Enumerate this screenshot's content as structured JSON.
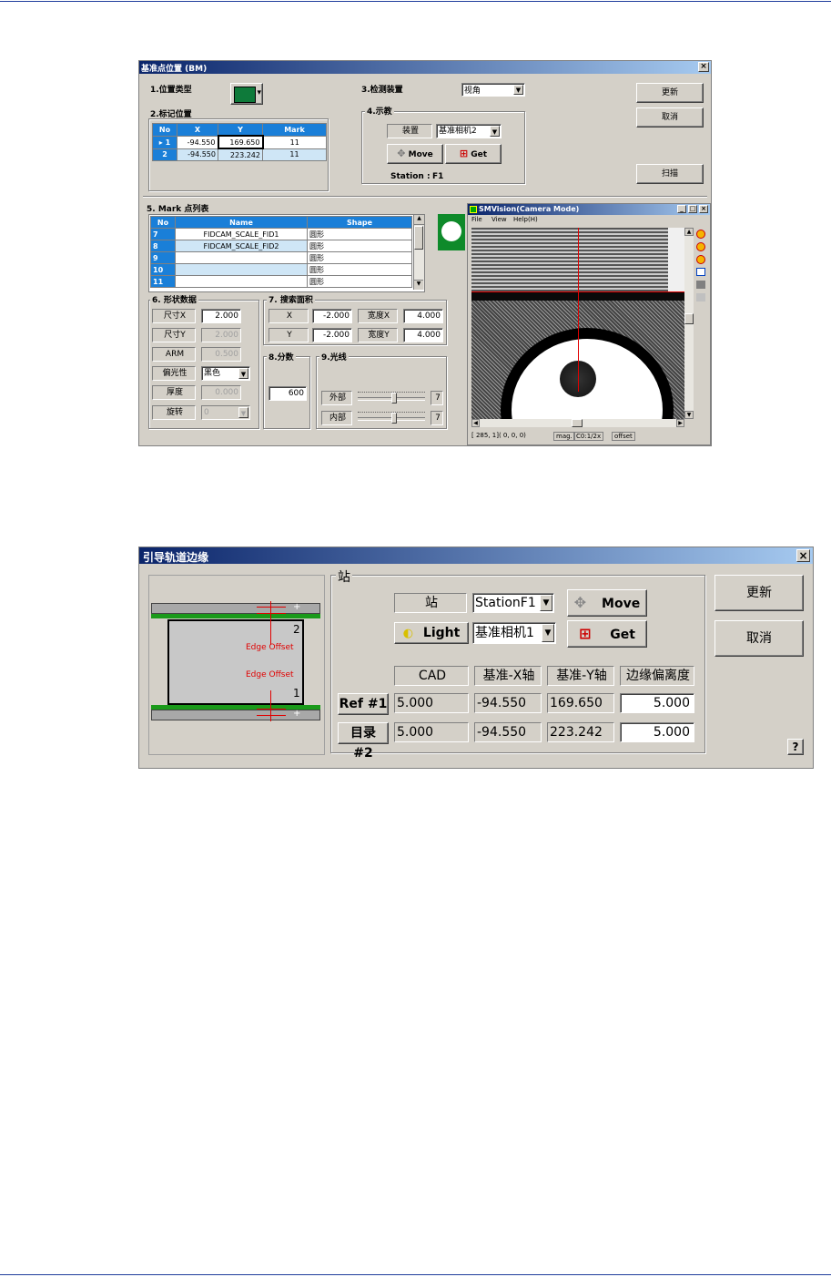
{
  "dialog1": {
    "title": "基准点位置 (BM)",
    "close_label": "×",
    "sec1_label": "1.位置类型",
    "sec2_label": "2.标记位置",
    "sec3_label": "3.检测装置",
    "detect_select": "视角",
    "sec4_label": "4.示教",
    "device_label": "装置",
    "device_select": "基准相机2",
    "move_label": "Move",
    "get_label": "Get",
    "station_text": "Station :",
    "station_value": "F1",
    "update_button": "更新",
    "cancel_button": "取消",
    "scan_button": "扫描",
    "mark_table": {
      "headers": [
        "No",
        "X",
        "Y",
        "Mark"
      ],
      "rows": [
        {
          "no": "1",
          "x": "-94.550",
          "y": "169.650",
          "mark": "11"
        },
        {
          "no": "2",
          "x": "-94.550",
          "y": "223.242",
          "mark": "11"
        }
      ]
    },
    "sec5_label": "5. Mark 点列表",
    "list_table": {
      "headers": [
        "No",
        "Name",
        "Shape"
      ],
      "rows": [
        {
          "no": "7",
          "name": "FIDCAM_SCALE_FID1",
          "shape": "圆形"
        },
        {
          "no": "8",
          "name": "FIDCAM_SCALE_FID2",
          "shape": "圆形"
        },
        {
          "no": "9",
          "name": "",
          "shape": "圆形"
        },
        {
          "no": "10",
          "name": "",
          "shape": "圆形"
        },
        {
          "no": "11",
          "name": "",
          "shape": "圆形"
        }
      ]
    },
    "sec6_label": "6. 形状数据",
    "size_x_label": "尺寸X",
    "size_x_value": "2.000",
    "size_y_label": "尺寸Y",
    "size_y_value": "2.000",
    "arm_label": "ARM",
    "arm_value": "0.500",
    "polarity_label": "偏光性",
    "polarity_value": "黑色",
    "thickness_label": "厚度",
    "thickness_value": "0.000",
    "rotate_label": "旋转",
    "rotate_value": "0",
    "sec7_label": "7. 搜索面积",
    "search_x_label": "X",
    "search_x_value": "-2.000",
    "width_x_label": "宽度X",
    "width_x_value": "4.000",
    "search_y_label": "Y",
    "search_y_value": "-2.000",
    "width_y_label": "宽度Y",
    "width_y_value": "4.000",
    "sec8_label": "8.分数",
    "score_value": "600",
    "sec9_label": "9.光线",
    "outer_label": "外部",
    "outer_value": "7",
    "outer_level": 0.55,
    "inner_label": "内部",
    "inner_value": "7",
    "inner_level": 0.55
  },
  "camera": {
    "title": "SMVision(Camera Mode)",
    "menu": [
      "File",
      "View",
      "Help(H)"
    ],
    "status": [
      "[ 285, 1]( 0, 0, 0)",
      "mag.",
      "C0:1/2x",
      "offset"
    ]
  },
  "dialog2": {
    "title": "引导轨道边缘",
    "close_label": "×",
    "diagram": {
      "edge_offset_1": "Edge Offset",
      "edge_offset_2": "Edge Offset",
      "num_2": "2",
      "num_1": "1",
      "plus_top": "+",
      "plus_bottom": "+"
    },
    "station_group": "站",
    "station_label": "站",
    "station_select": "StationF1",
    "move_label": "Move",
    "light_label": "Light",
    "camera_select": "基准相机1",
    "get_label": "Get",
    "col_headers": [
      "CAD",
      "基准-X轴",
      "基准-Y轴",
      "边缘偏离度"
    ],
    "rows": [
      {
        "label": "Ref #1",
        "cad": "5.000",
        "x": "-94.550",
        "y": "169.650",
        "offset": "5.000"
      },
      {
        "label": "目录 #2",
        "cad": "5.000",
        "x": "-94.550",
        "y": "223.242",
        "offset": "5.000"
      }
    ],
    "update_button": "更新",
    "cancel_button": "取消",
    "help_button": "?"
  },
  "colors": {
    "title_blue": "#0a246a",
    "dialog_gray": "#d4d0c8",
    "table_header": "#1a7fd8",
    "rail_green": "#1a9a1a",
    "marker_red": "#e00000"
  }
}
